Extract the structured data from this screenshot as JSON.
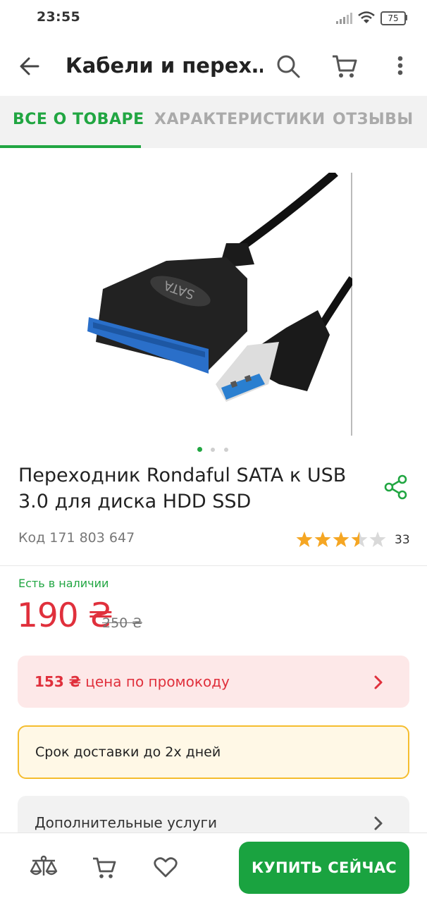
{
  "status_bar": {
    "time": "23:55",
    "battery": "75"
  },
  "header": {
    "title": "Кабели и перех…"
  },
  "tabs": [
    {
      "label": "ВСЕ О ТОВАРЕ",
      "active": true
    },
    {
      "label": "ХАРАКТЕРИСТИКИ",
      "active": false
    },
    {
      "label": "ОТЗЫВЫ",
      "active": false
    }
  ],
  "product": {
    "image_label": "SATA",
    "title": "Переходник Rondaful SATA к USB 3.0 для диска HDD SSD",
    "code": "Код 171 803 647",
    "rating": {
      "value": 3.5,
      "max": 5,
      "count": "33"
    },
    "availability": "Есть в наличии",
    "price": "190 ₴",
    "old_price": "250 ₴",
    "gallery": {
      "current": 1,
      "total": 3
    }
  },
  "promo": {
    "amount": "153 ₴",
    "text": " цена по промокоду"
  },
  "delivery": {
    "text": "Срок доставки до 2х дней"
  },
  "services": {
    "label": "Дополнительные услуги"
  },
  "bottom_bar": {
    "buy_label": "КУПИТЬ СЕЙЧАС"
  },
  "colors": {
    "accent": "#1aa340",
    "price": "#e0303c",
    "star": "#f5a623"
  }
}
